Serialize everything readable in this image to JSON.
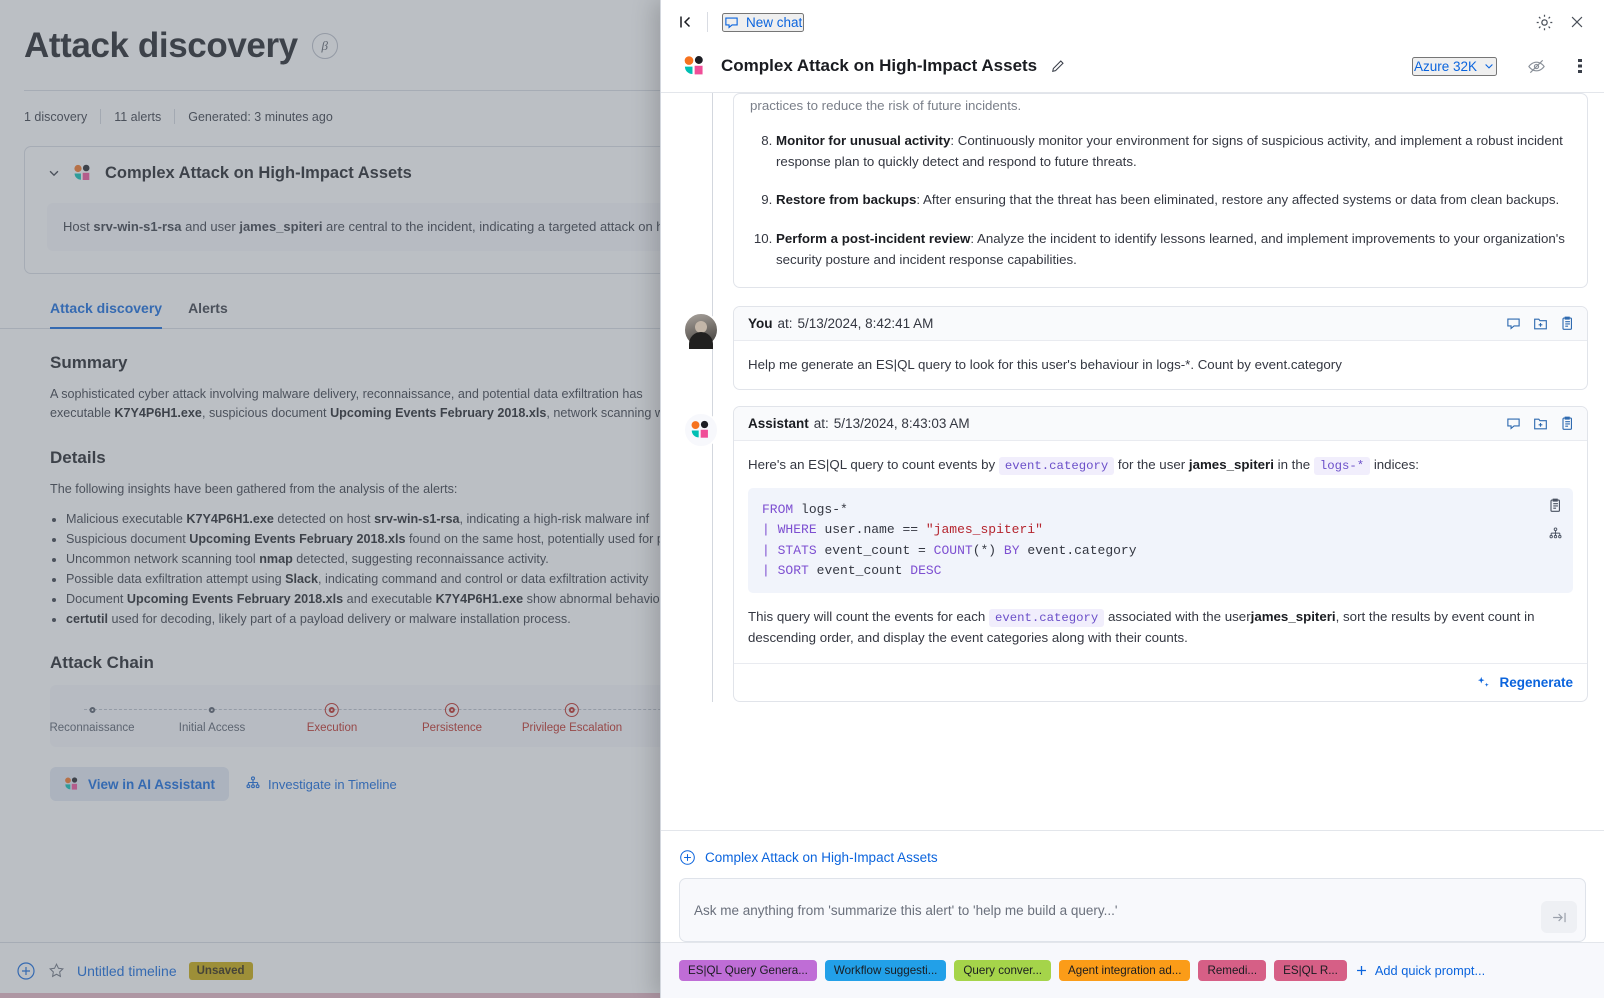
{
  "background_page": {
    "title": "Attack discovery",
    "beta_badge": "β",
    "meta": {
      "discoveries": "1 discovery",
      "alerts": "11 alerts",
      "generated": "Generated: 3 minutes ago"
    },
    "discovery": {
      "title": "Complex Attack on High-Impact Assets",
      "summary_line": "Host srv-win-s1-rsa and user james_spiteri are central to the incident, indicating a targeted attack on high"
    },
    "tabs": [
      {
        "label": "Attack discovery",
        "active": true
      },
      {
        "label": "Alerts",
        "active": false
      }
    ],
    "summary": {
      "heading": "Summary",
      "paragraph": "A sophisticated cyber attack involving malware delivery, reconnaissance, and potential data exfiltration has executable K7Y4P6H1.exe, suspicious document Upcoming Events February 2018.xls, network scanning w"
    },
    "details": {
      "heading": "Details",
      "intro": "The following insights have been gathered from the analysis of the alerts:",
      "bullets": [
        "Malicious executable K7Y4P6H1.exe detected on host srv-win-s1-rsa, indicating a high-risk malware inf",
        "Suspicious document Upcoming Events February 2018.xls found on the same host, potentially used for p",
        "Uncommon network scanning tool nmap detected, suggesting reconnaissance activity.",
        "Possible data exfiltration attempt using Slack, indicating command and control or data exfiltration activity",
        "Document Upcoming Events February 2018.xls and executable K7Y4P6H1.exe show abnormal behavior",
        "certutil used for decoding, likely part of a payload delivery or malware installation process."
      ]
    },
    "attack_chain": {
      "heading": "Attack Chain",
      "stages": [
        {
          "label": "Reconnaissance",
          "hit": false
        },
        {
          "label": "Initial Access",
          "hit": false
        },
        {
          "label": "Execution",
          "hit": true
        },
        {
          "label": "Persistence",
          "hit": true
        },
        {
          "label": "Privilege Escalation",
          "hit": true
        }
      ]
    },
    "actions": {
      "view_in_ai_assistant": "View in AI Assistant",
      "investigate_in_timeline": "Investigate in Timeline"
    },
    "bottom_bar": {
      "timeline_name": "Untitled timeline",
      "status_badge": "Unsaved"
    }
  },
  "flyout": {
    "topbar": {
      "collapse_icon": "collapse-left-icon",
      "new_chat_label": "New chat",
      "settings_icon": "gear-icon",
      "close_icon": "close-icon"
    },
    "header": {
      "conversation_title": "Complex Attack on High-Impact Assets",
      "edit_icon": "pencil-icon",
      "connector_label": "Azure 32K",
      "anonymize_icon": "eye-slash-icon",
      "menu_icon": "dots-vertical-icon"
    },
    "top_fragment": {
      "partial_line": "practices to reduce the risk of future incidents.",
      "steps": [
        {
          "number": "8.",
          "title": "Monitor for unusual activity",
          "text": ": Continuously monitor your environment for signs of suspicious activity, and implement a robust incident response plan to quickly detect and respond to future threats."
        },
        {
          "number": "9.",
          "title": "Restore from backups",
          "text": ": After ensuring that the threat has been eliminated, restore any affected systems or data from clean backups."
        },
        {
          "number": "10.",
          "title": "Perform a post-incident review",
          "text": ": Analyze the incident to identify lessons learned, and implement improvements to your organization's security posture and incident response capabilities."
        }
      ]
    },
    "messages": [
      {
        "role": "You",
        "timestamp_prefix": "at:",
        "timestamp": "5/13/2024, 8:42:41 AM",
        "body": "Help me generate an ES|QL query to look for this user's behaviour in logs-*. Count by event.category"
      },
      {
        "role": "Assistant",
        "timestamp_prefix": "at:",
        "timestamp": "5/13/2024, 8:43:03 AM",
        "intro_part1": "Here's an ES|QL query to count events by",
        "intro_code1": "event.category",
        "intro_part2": "for the user",
        "intro_bold": "james_spiteri",
        "intro_part3": "in the",
        "intro_code2": "logs-*",
        "intro_part4": "indices:",
        "code_lines": [
          "FROM logs-*",
          "| WHERE user.name == \"james_spiteri\"",
          "| STATS event_count = COUNT(*) BY event.category",
          "| SORT event_count DESC"
        ],
        "outro_part1": "This query will count the events for each",
        "outro_code1": "event.category",
        "outro_part2": "associated with the user",
        "outro_bold": "james_spiteri",
        "outro_part3": ", sort the results by event count in descending order, and display the event categories along with their counts.",
        "regenerate_label": "Regenerate"
      }
    ],
    "message_actions": [
      "comment-icon",
      "add-to-case-icon",
      "copy-icon"
    ],
    "code_actions": [
      "copy-icon",
      "investigate-in-timeline-icon"
    ],
    "footer": {
      "context_label": "Complex Attack on High-Impact Assets",
      "context_icon": "plus-circle-icon",
      "prompt_placeholder": "Ask me anything from 'summarize this alert' to 'help me build a query...'",
      "prompt_value": "",
      "send_icon": "send-icon"
    },
    "quick_prompts": [
      {
        "label": "ES|QL Query Genera...",
        "color": "#bf6dd6"
      },
      {
        "label": "Workflow suggesti...",
        "color": "#22a0e8"
      },
      {
        "label": "Query conver...",
        "color": "#a5d44a"
      },
      {
        "label": "Agent integration ad...",
        "color": "#fb9c18"
      },
      {
        "label": "Remedi...",
        "color": "#d65f86"
      },
      {
        "label": "ES|QL R...",
        "color": "#d65f86"
      }
    ],
    "add_quick_prompt_label": "Add quick prompt..."
  },
  "colors": {
    "link": "#0b64dd",
    "danger": "#bd271e",
    "code_keyword": "#7d4fd1",
    "code_string": "#b5252f",
    "inline_code_bg": "#f1eefc"
  }
}
